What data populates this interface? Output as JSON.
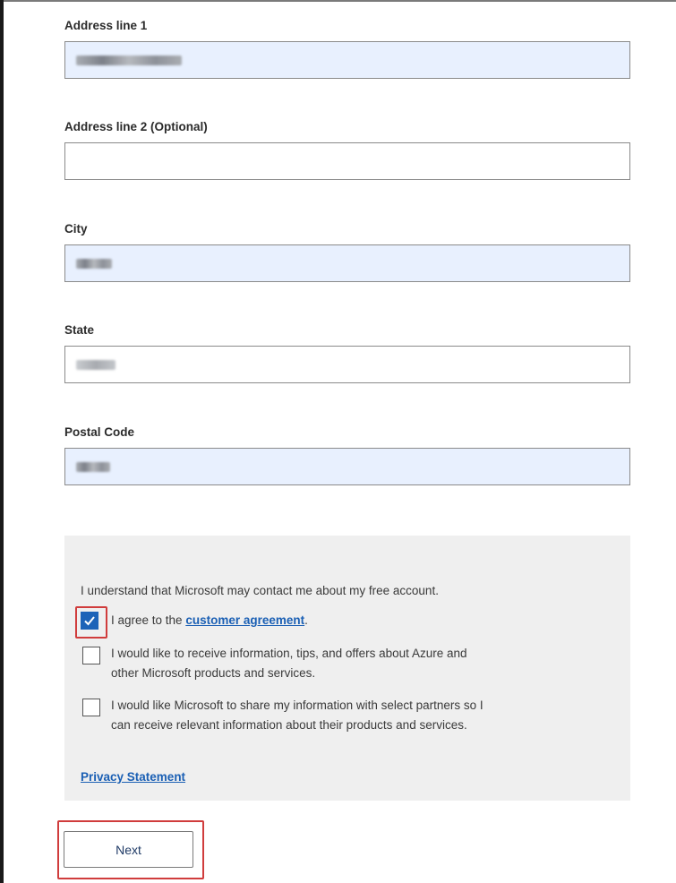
{
  "form": {
    "address1": {
      "label": "Address line 1",
      "value": ""
    },
    "address2": {
      "label": "Address line 2 (Optional)",
      "value": ""
    },
    "city": {
      "label": "City",
      "value": ""
    },
    "state": {
      "label": "State",
      "value": ""
    },
    "postal": {
      "label": "Postal Code",
      "value": ""
    }
  },
  "consent": {
    "notice": "I understand that Microsoft may contact me about my free account.",
    "agree_prefix": "I agree to the ",
    "agree_link": "customer agreement",
    "agree_suffix": ".",
    "agree_checked": true,
    "info_line1": "I would like to receive information, tips, and offers about Azure and",
    "info_line2": "other Microsoft products and services.",
    "info_checked": false,
    "share_line1": "I would like Microsoft to share my information with select partners so I",
    "share_line2": "can receive relevant information about their products and services.",
    "share_checked": false,
    "privacy_link": "Privacy Statement"
  },
  "actions": {
    "next_label": "Next"
  },
  "colors": {
    "accent": "#1d63b8",
    "highlight": "#d03c3c",
    "filled_field": "#e8f0fe"
  }
}
